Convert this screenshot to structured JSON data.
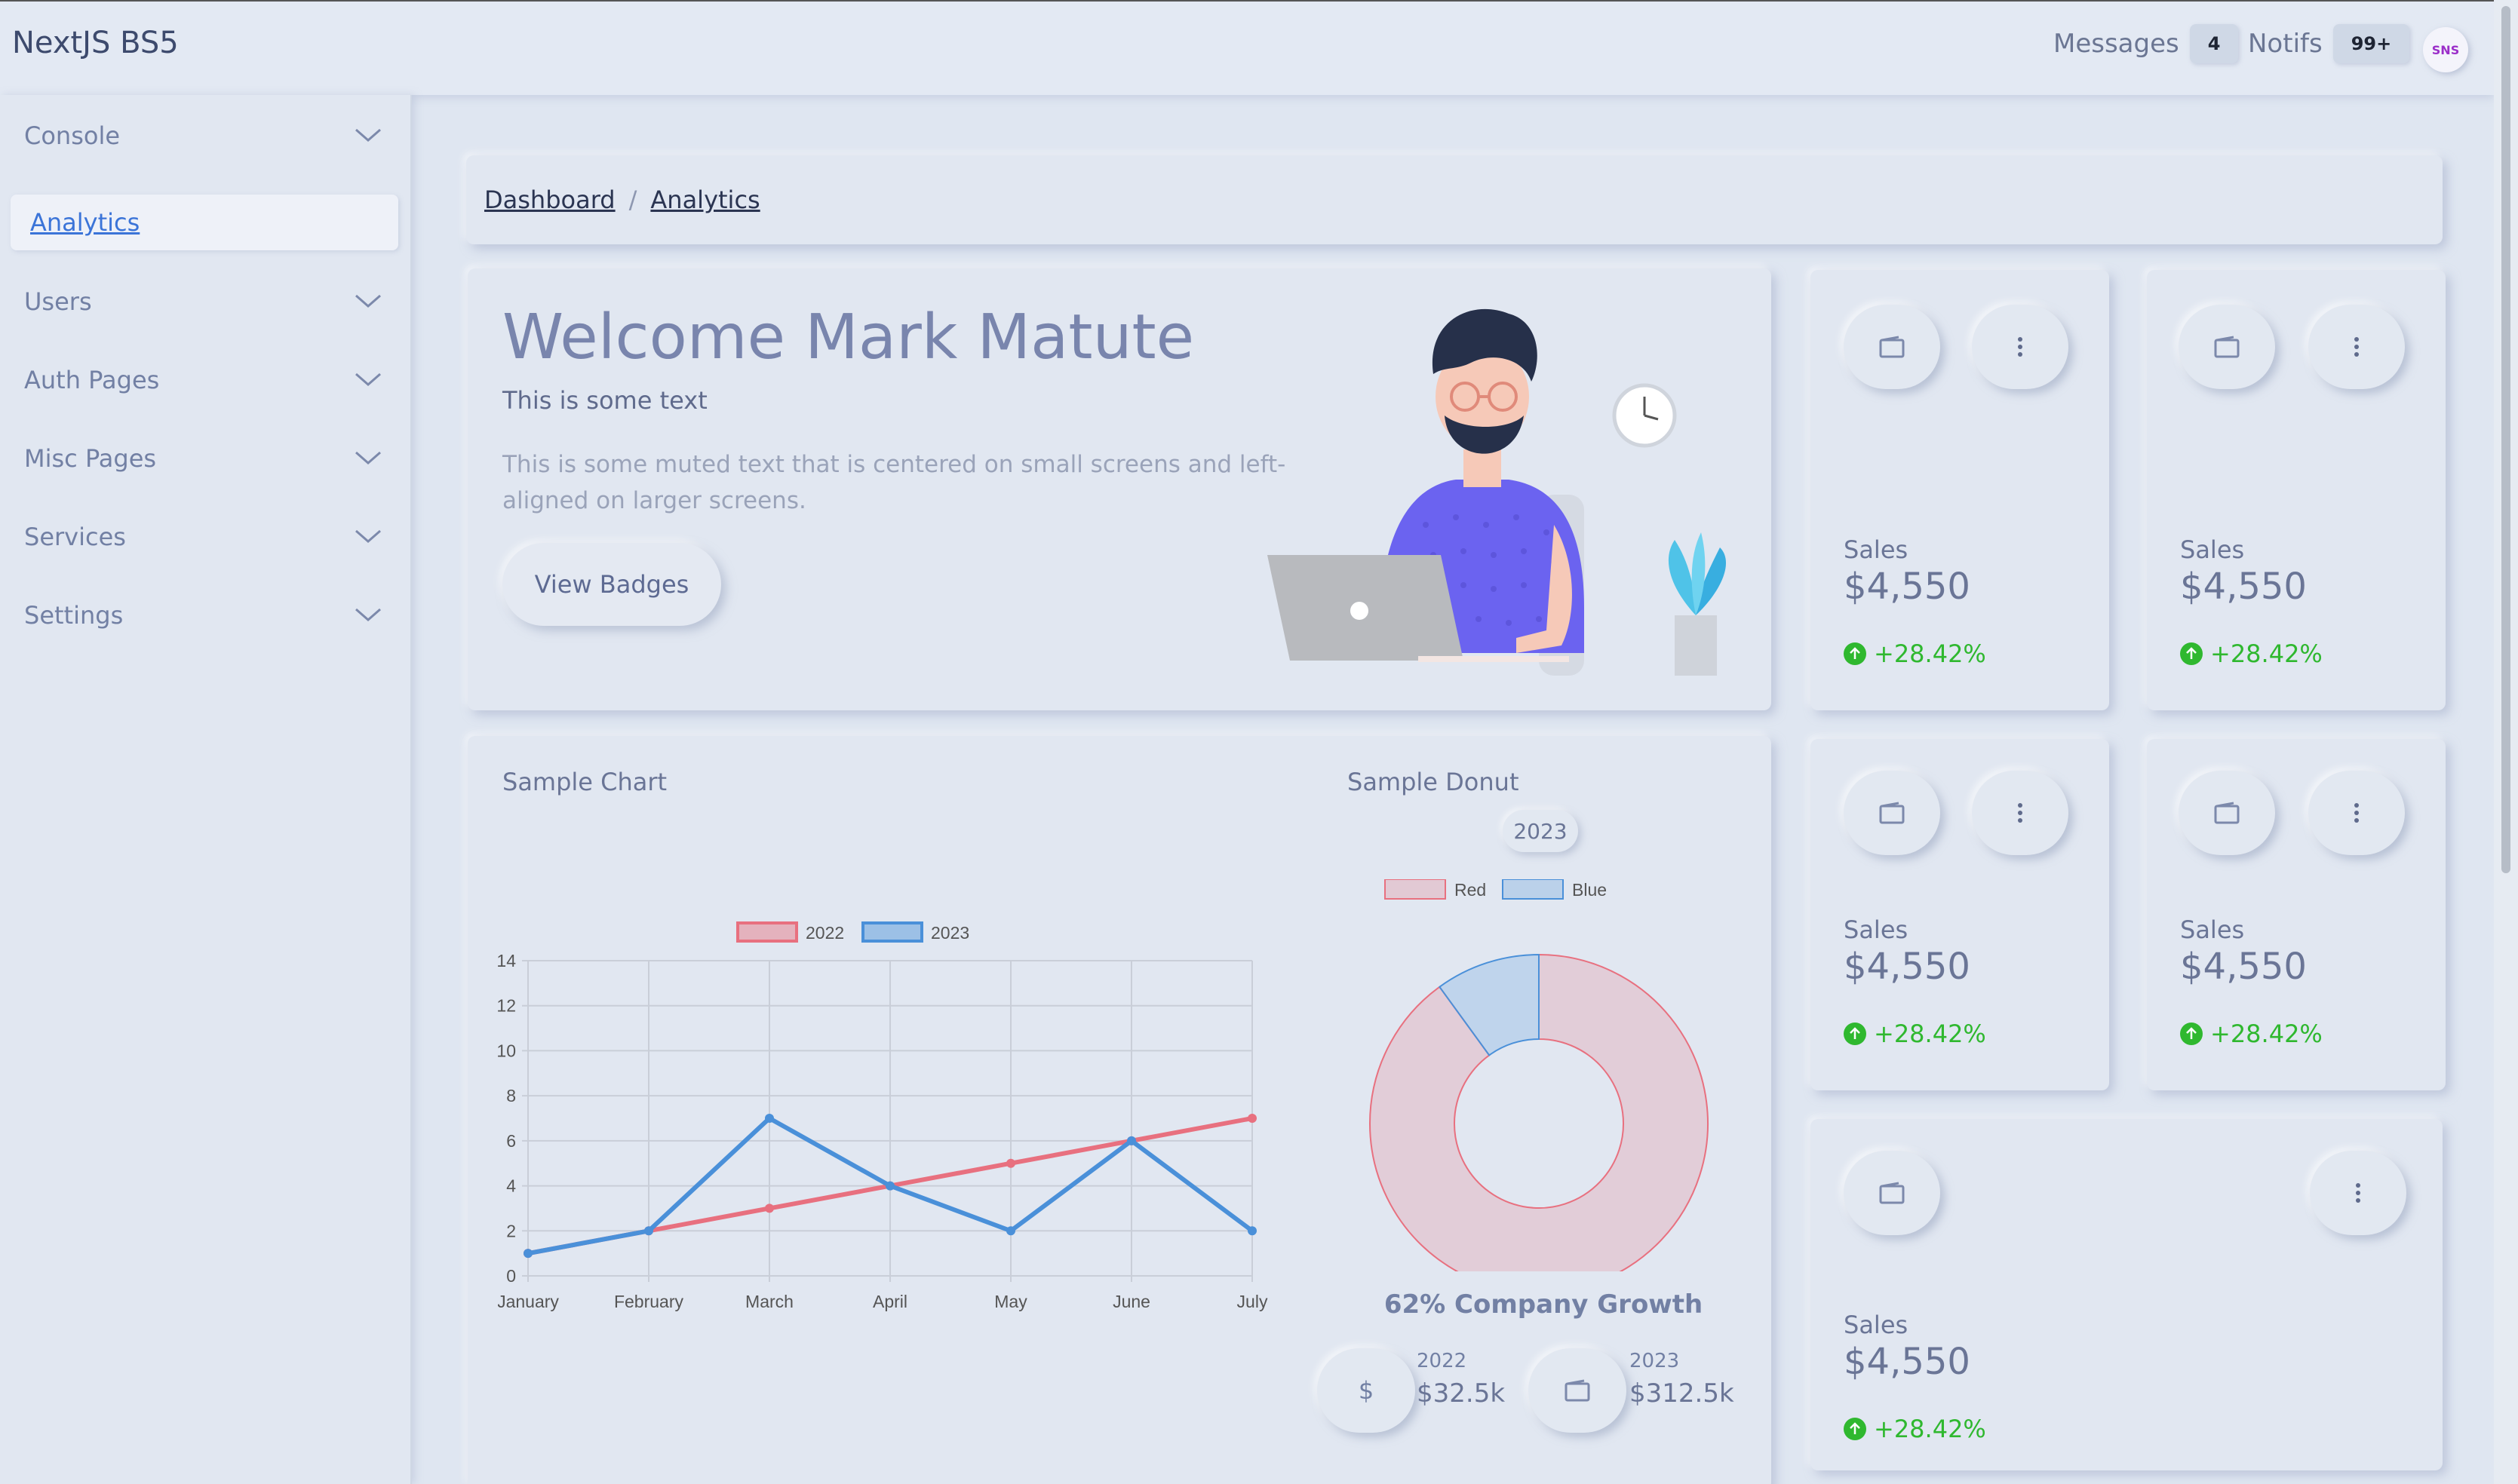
{
  "app": {
    "brand": "NextJS BS5"
  },
  "topbar": {
    "messages_label": "Messages",
    "messages_count": "4",
    "notifs_label": "Notifs",
    "notifs_count": "99+",
    "avatar_text": "SNS"
  },
  "sidebar": {
    "items": [
      {
        "label": "Console"
      },
      {
        "label": "Analytics"
      },
      {
        "label": "Users"
      },
      {
        "label": "Auth Pages"
      },
      {
        "label": "Misc Pages"
      },
      {
        "label": "Services"
      },
      {
        "label": "Settings"
      }
    ]
  },
  "breadcrumb": {
    "items": [
      "Dashboard",
      "Analytics"
    ],
    "separator": "/"
  },
  "welcome": {
    "title": "Welcome Mark Matute",
    "subtitle": "This is some text",
    "muted": "This is some muted text that is centered on small screens and left-aligned on larger screens.",
    "button": "View Badges"
  },
  "stats": [
    {
      "label": "Sales",
      "value": "$4,550",
      "change": "+28.42%"
    },
    {
      "label": "Sales",
      "value": "$4,550",
      "change": "+28.42%"
    },
    {
      "label": "Sales",
      "value": "$4,550",
      "change": "+28.42%"
    },
    {
      "label": "Sales",
      "value": "$4,550",
      "change": "+28.42%"
    },
    {
      "label": "Sales",
      "value": "$4,550",
      "change": "+28.42%"
    }
  ],
  "line_chart": {
    "title": "Sample Chart"
  },
  "donut_chart": {
    "title": "Sample Donut",
    "year": "2023",
    "growth": "62% Company Growth",
    "mini": [
      {
        "icon": "$",
        "year": "2022",
        "value": "$32.5k"
      },
      {
        "icon": "wallet",
        "year": "2023",
        "value": "$312.5k"
      }
    ]
  },
  "colors": {
    "red": "#e8707f",
    "blue": "#4a90d9",
    "success": "#2fb82f",
    "link": "#3b74d8"
  },
  "chart_data": [
    {
      "type": "line",
      "title": "Sample Chart",
      "categories": [
        "January",
        "February",
        "March",
        "April",
        "May",
        "June",
        "July"
      ],
      "series": [
        {
          "name": "2022",
          "values": [
            1,
            2,
            3,
            4,
            5,
            6,
            7
          ],
          "color": "#e8707f"
        },
        {
          "name": "2023",
          "values": [
            1,
            2,
            7,
            4,
            2,
            6,
            2
          ],
          "color": "#4a90d9"
        }
      ],
      "ylim": [
        0,
        14
      ],
      "yticks": [
        "0",
        "2",
        "4",
        "6",
        "8",
        "10",
        "12",
        "14"
      ],
      "grid": true,
      "legend": "top"
    },
    {
      "type": "pie",
      "title": "Sample Donut",
      "subtitle": "2023",
      "labels": [
        "Red",
        "Blue"
      ],
      "values": [
        90,
        10
      ],
      "colors": [
        "#e8707f",
        "#4a90d9"
      ],
      "legend": "top"
    }
  ]
}
